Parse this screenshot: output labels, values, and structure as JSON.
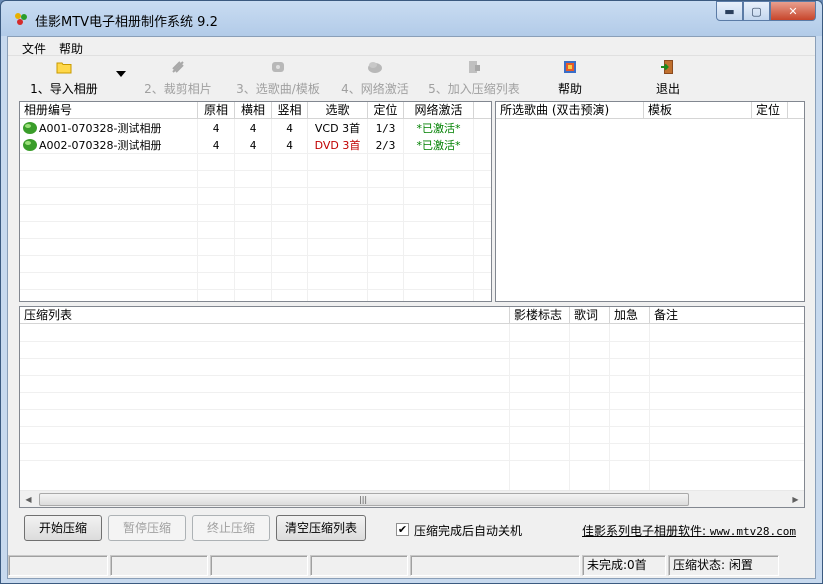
{
  "window": {
    "title": "佳影MTV电子相册制作系统 9.2"
  },
  "colors": {
    "activated_text": "#008000",
    "dvd_text": "#c00000",
    "window_frame": "#c7d9ee"
  },
  "menu": {
    "items": [
      {
        "label": "文件"
      },
      {
        "label": "帮助"
      }
    ]
  },
  "toolbar": {
    "buttons": [
      {
        "label": "1、导入相册",
        "icon": "folder-icon",
        "enabled": true
      },
      {
        "label": "2、裁剪相片",
        "icon": "crop-icon",
        "enabled": false
      },
      {
        "label": "3、选歌曲/模板",
        "icon": "song-template-icon",
        "enabled": false
      },
      {
        "label": "4、网络激活",
        "icon": "network-cloud-icon",
        "enabled": false
      },
      {
        "label": "5、加入压缩列表",
        "icon": "compress-list-icon",
        "enabled": false
      },
      {
        "label": "帮助",
        "icon": "help-book-icon",
        "enabled": true
      },
      {
        "label": "退出",
        "icon": "exit-door-icon",
        "enabled": true
      }
    ]
  },
  "album_table": {
    "columns": [
      "相册编号",
      "原相",
      "横相",
      "竖相",
      "选歌",
      "定位",
      "网络激活"
    ],
    "rows": [
      {
        "id": "A001-070328-测试相册",
        "original": "4",
        "landscape": "4",
        "portrait": "4",
        "songs": "VCD 3首",
        "position": "1/3",
        "activation": "*已激活*",
        "songs_color": "normal"
      },
      {
        "id": "A002-070328-测试相册",
        "original": "4",
        "landscape": "4",
        "portrait": "4",
        "songs": "DVD 3首",
        "position": "2/3",
        "activation": "*已激活*",
        "songs_color": "red"
      }
    ]
  },
  "song_table": {
    "columns": [
      "所选歌曲 (双击预演)",
      "模板",
      "定位"
    ]
  },
  "compress_table": {
    "columns": [
      "压缩列表",
      "影楼标志",
      "歌词",
      "加急",
      "备注"
    ]
  },
  "buttons": {
    "start": "开始压缩",
    "pause": "暂停压缩",
    "stop": "终止压缩",
    "clear": "清空压缩列表"
  },
  "auto_shutdown": {
    "label": "压缩完成后自动关机",
    "checked": true,
    "check_mark": "✔"
  },
  "link": {
    "text": "佳影系列电子相册软件:",
    "url": "www.mtv28.com"
  },
  "status": {
    "unfinished": "未完成:0首",
    "compress_state": "压缩状态: 闲置"
  }
}
